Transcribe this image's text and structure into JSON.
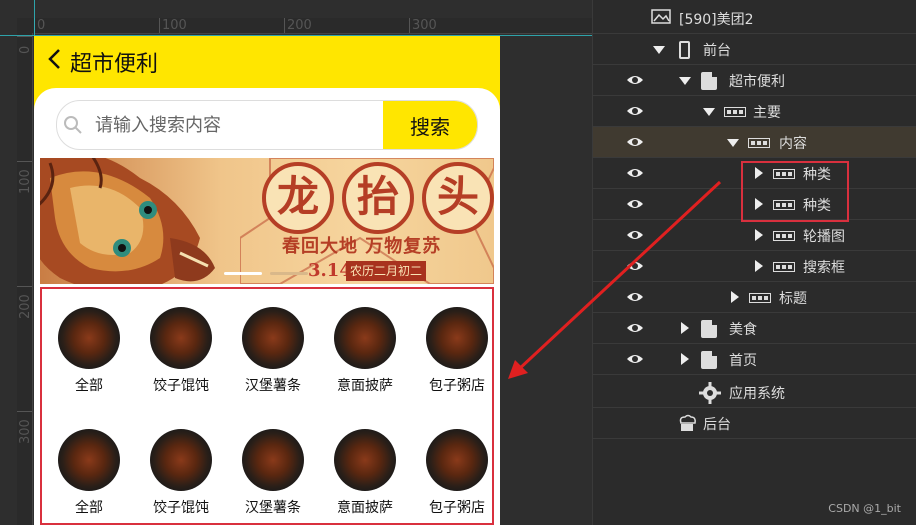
{
  "ruler": {
    "top_ticks": [
      "0",
      "100",
      "200",
      "300"
    ],
    "left_ticks": [
      "0",
      "100",
      "200",
      "300"
    ]
  },
  "page": {
    "title": "超市便利",
    "search_placeholder": "请输入搜索内容",
    "search_button": "搜索",
    "banner": {
      "title_chars": [
        "龙",
        "抬",
        "头"
      ],
      "subtitle": "春回大地  万物复苏",
      "date": "3.14",
      "lunar": "农历二月初二"
    },
    "categories_row1": [
      "全部",
      "饺子馄饨",
      "汉堡薯条",
      "意面披萨",
      "包子粥店"
    ],
    "categories_row2": [
      "全部",
      "饺子馄饨",
      "汉堡薯条",
      "意面披萨",
      "包子粥店"
    ]
  },
  "layers": [
    {
      "label": "[590]美团2",
      "icon": "app-icon",
      "eye": false,
      "arrow": "none"
    },
    {
      "label": "前台",
      "icon": "phone-icon",
      "eye": false,
      "arrow": "down"
    },
    {
      "label": "超市便利",
      "icon": "page-icon",
      "eye": true,
      "arrow": "down"
    },
    {
      "label": "主要",
      "icon": "grid-icon",
      "eye": true,
      "arrow": "down"
    },
    {
      "label": "内容",
      "icon": "grid-icon",
      "eye": true,
      "arrow": "down",
      "selected": true
    },
    {
      "label": "种类",
      "icon": "grid-icon",
      "eye": true,
      "arrow": "right"
    },
    {
      "label": "种类",
      "icon": "grid-icon",
      "eye": true,
      "arrow": "right"
    },
    {
      "label": "轮播图",
      "icon": "grid-icon",
      "eye": true,
      "arrow": "right"
    },
    {
      "label": "搜索框",
      "icon": "grid-icon",
      "eye": true,
      "arrow": "right"
    },
    {
      "label": "标题",
      "icon": "grid-icon",
      "eye": true,
      "arrow": "right"
    },
    {
      "label": "美食",
      "icon": "page-icon",
      "eye": true,
      "arrow": "right"
    },
    {
      "label": "首页",
      "icon": "page-icon",
      "eye": true,
      "arrow": "right"
    },
    {
      "label": "应用系统",
      "icon": "gear-icon",
      "eye": false,
      "arrow": "none"
    },
    {
      "label": "后台",
      "icon": "cloud-icon",
      "eye": false,
      "arrow": "none"
    }
  ],
  "credit": "CSDN @1_bit",
  "colors": {
    "accent": "#ffe600",
    "highlight": "#d9303e"
  }
}
